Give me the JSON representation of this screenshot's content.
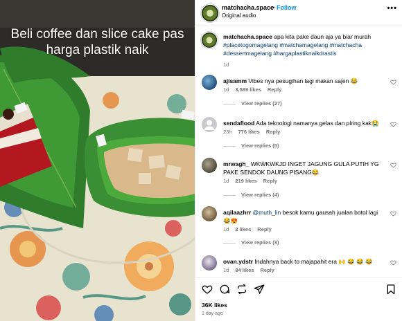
{
  "post": {
    "overlay_text": "Beli coffee dan slice cake pas harga plastik naik",
    "username": "matchacha.space",
    "separator": "•",
    "follow_label": "Follow",
    "audio": "Original audio",
    "more": "•••",
    "caption_user": "matchacha.space",
    "caption_text": "apa kita pake daun aja ya biar murah",
    "hashtags": [
      "#placetogomagelang",
      "#matchamagelang",
      "#matchacha",
      "#dessertmagelang",
      "#hargaplastiknaikdrastis"
    ],
    "caption_age": "1d",
    "likes": "36K likes",
    "posted": "1 day ago"
  },
  "comments": [
    {
      "user": "ajisamm",
      "text": "Vibes nya pesugihan lagi makan sajen 😂",
      "age": "1d",
      "likes": "3,589 likes",
      "reply": "Reply",
      "view_replies": "View replies (27)"
    },
    {
      "user": "sendaflood",
      "text": "Ada teknologi namanya gelas dan piring kak😭",
      "age": "23h",
      "likes": "776 likes",
      "reply": "Reply",
      "view_replies": "View replies (5)"
    },
    {
      "user": "mrwagh_",
      "text": "WKWKWKJD INGET JAGUNG GULA PUTIH YG PAKE SENDOK DAUNG PISANG😂",
      "age": "1d",
      "likes": "219 likes",
      "reply": "Reply",
      "view_replies": "View replies (4)"
    },
    {
      "user": "aqilaazhrr",
      "mention": "@muth_lin",
      "text": "besok kamu gausah jualan botol lagi 😂😍",
      "age": "1d",
      "likes": "2 likes",
      "reply": "Reply",
      "view_replies": "View replies (3)"
    },
    {
      "user": "ovan.ydstr",
      "text": "Indahnya back to majapahit era 🙌 😂 😂 😂",
      "age": "1d",
      "likes": "84 likes",
      "reply": "Reply"
    }
  ],
  "icons": {
    "like": "heart-icon",
    "comment": "comment-bubble-icon",
    "share": "repost-icon",
    "send": "send-icon",
    "save": "bookmark-icon"
  },
  "colors": {
    "follow": "#0095f6",
    "hashtag": "#00376b",
    "muted": "#737373"
  }
}
